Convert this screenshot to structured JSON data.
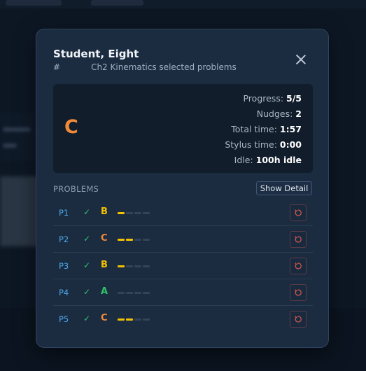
{
  "modal": {
    "student_name": "Student, Eight",
    "hash_prefix": "#",
    "assignment": "Ch2 Kinematics selected problems",
    "grade": "C",
    "grade_color": "#f08a3a",
    "stats": [
      {
        "label": "Progress:",
        "value": "5/5"
      },
      {
        "label": "Nudges:",
        "value": "2"
      },
      {
        "label": "Total time:",
        "value": "1:57"
      },
      {
        "label": "Stylus time:",
        "value": "0:00"
      },
      {
        "label": "Idle:",
        "value": "100h idle"
      }
    ],
    "problems_heading": "PROBLEMS",
    "show_detail_label": "Show Detail",
    "problems": [
      {
        "label": "P1",
        "check": "✓",
        "grade": "B",
        "grade_color": "#f2c200",
        "bars_filled": 1,
        "bars_total": 4
      },
      {
        "label": "P2",
        "check": "✓",
        "grade": "C",
        "grade_color": "#f08a3a",
        "bars_filled": 2,
        "bars_total": 4
      },
      {
        "label": "P3",
        "check": "✓",
        "grade": "B",
        "grade_color": "#f2c200",
        "bars_filled": 1,
        "bars_total": 4
      },
      {
        "label": "P4",
        "check": "✓",
        "grade": "A",
        "grade_color": "#32c26a",
        "bars_filled": 0,
        "bars_total": 4
      },
      {
        "label": "P5",
        "check": "✓",
        "grade": "C",
        "grade_color": "#f08a3a",
        "bars_filled": 2,
        "bars_total": 4
      }
    ]
  }
}
